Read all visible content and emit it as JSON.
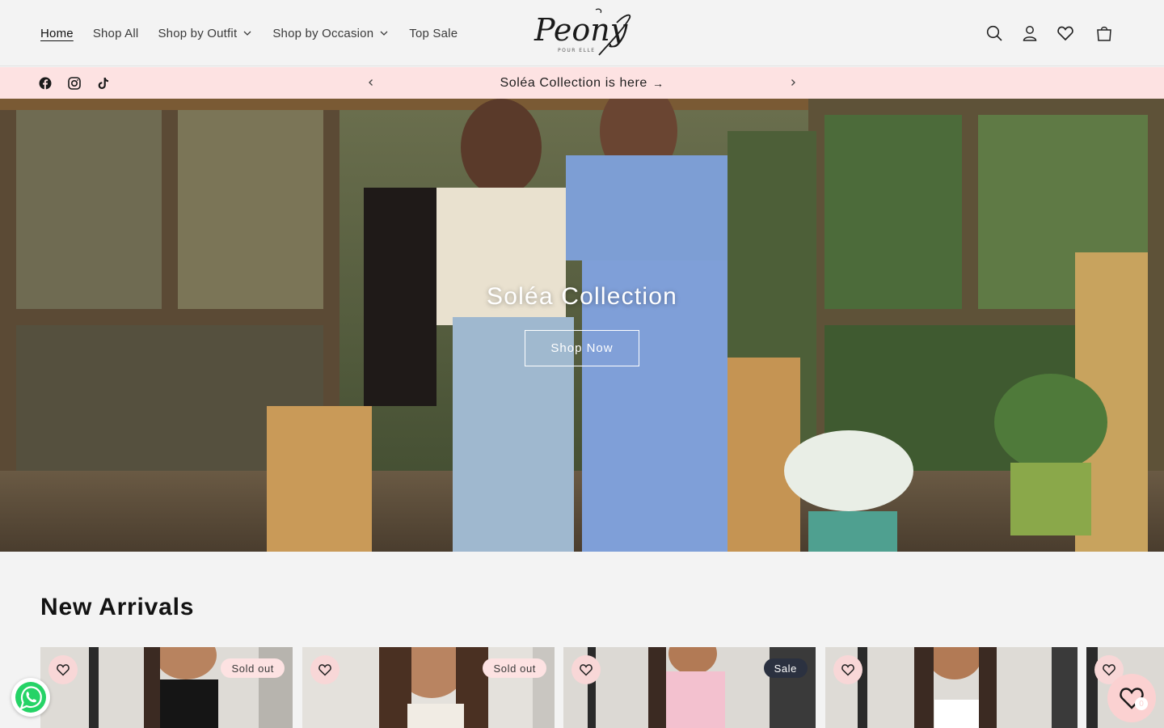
{
  "header": {
    "nav": [
      {
        "label": "Home",
        "active": true,
        "dropdown": false
      },
      {
        "label": "Shop All",
        "active": false,
        "dropdown": false
      },
      {
        "label": "Shop by Outfit",
        "active": false,
        "dropdown": true
      },
      {
        "label": "Shop by Occasion",
        "active": false,
        "dropdown": true
      },
      {
        "label": "Top Sale",
        "active": false,
        "dropdown": false
      }
    ],
    "logo_text": "Peony",
    "logo_sub": "POUR ELLE",
    "icons": [
      "search-icon",
      "account-icon",
      "wishlist-icon",
      "cart-icon"
    ]
  },
  "announcement": {
    "text": "Soléa Collection is here",
    "arrow": "→",
    "socials": [
      "facebook-icon",
      "instagram-icon",
      "tiktok-icon"
    ],
    "bg_color": "#fde2e2"
  },
  "hero": {
    "title": "Soléa Collection",
    "button": "Shop Now"
  },
  "new_arrivals": {
    "title": "New Arrivals",
    "products": [
      {
        "badge": "Sold out",
        "badge_type": "sold"
      },
      {
        "badge": "Sold out",
        "badge_type": "sold"
      },
      {
        "badge": "Sale",
        "badge_type": "sale"
      },
      {
        "badge": "",
        "badge_type": ""
      },
      {
        "badge": "",
        "badge_type": ""
      }
    ]
  },
  "floating": {
    "whatsapp": "whatsapp-icon",
    "wishlist_count": "0"
  },
  "colors": {
    "accent_pink": "#fde2e2",
    "wish_pink": "#fbd1d1",
    "sale_badge": "#2b3140",
    "text": "#121212"
  }
}
